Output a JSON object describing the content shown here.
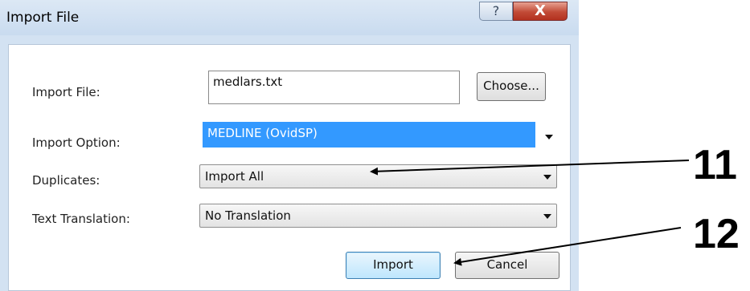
{
  "window": {
    "title": "Import File",
    "help_glyph": "?",
    "close_glyph": "X"
  },
  "form": {
    "import_file_label": "Import File:",
    "import_file_value": "medlars.txt",
    "choose_label": "Choose...",
    "import_option_label": "Import Option:",
    "import_option_value": "MEDLINE (OvidSP)",
    "duplicates_label": "Duplicates:",
    "duplicates_value": "Import All",
    "text_translation_label": "Text Translation:",
    "text_translation_value": "No Translation"
  },
  "buttons": {
    "import_label": "Import",
    "cancel_label": "Cancel"
  },
  "annotations": {
    "callout_11": "11",
    "callout_12": "12"
  }
}
